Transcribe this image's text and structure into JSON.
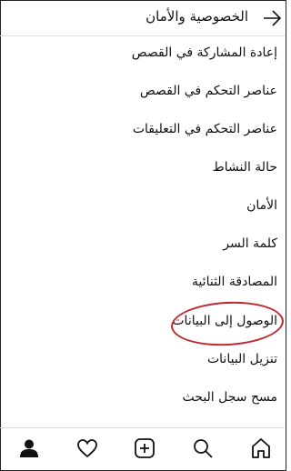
{
  "header": {
    "title": "الخصوصية والأمان",
    "back_icon": "arrow-right-icon"
  },
  "menu": {
    "items": [
      {
        "label": "إعادة المشاركة في القصص"
      },
      {
        "label": "عناصر التحكم في القصص"
      },
      {
        "label": "عناصر التحكم في التعليقات"
      },
      {
        "label": "حالة النشاط"
      },
      {
        "label": "الأمان"
      },
      {
        "label": "كلمة السر"
      },
      {
        "label": "المصادقة الثنائية"
      },
      {
        "label": "الوصول إلى البيانات"
      },
      {
        "label": "تنزيل البيانات"
      },
      {
        "label": "مسح سجل البحث"
      }
    ]
  },
  "tabbar": {
    "tabs": [
      {
        "icon": "profile-icon"
      },
      {
        "icon": "heart-icon"
      },
      {
        "icon": "add-post-icon"
      },
      {
        "icon": "search-icon"
      },
      {
        "icon": "home-icon"
      }
    ]
  },
  "colors": {
    "highlight": "#c0272d",
    "text": "#111111",
    "divider": "#dddddd"
  }
}
